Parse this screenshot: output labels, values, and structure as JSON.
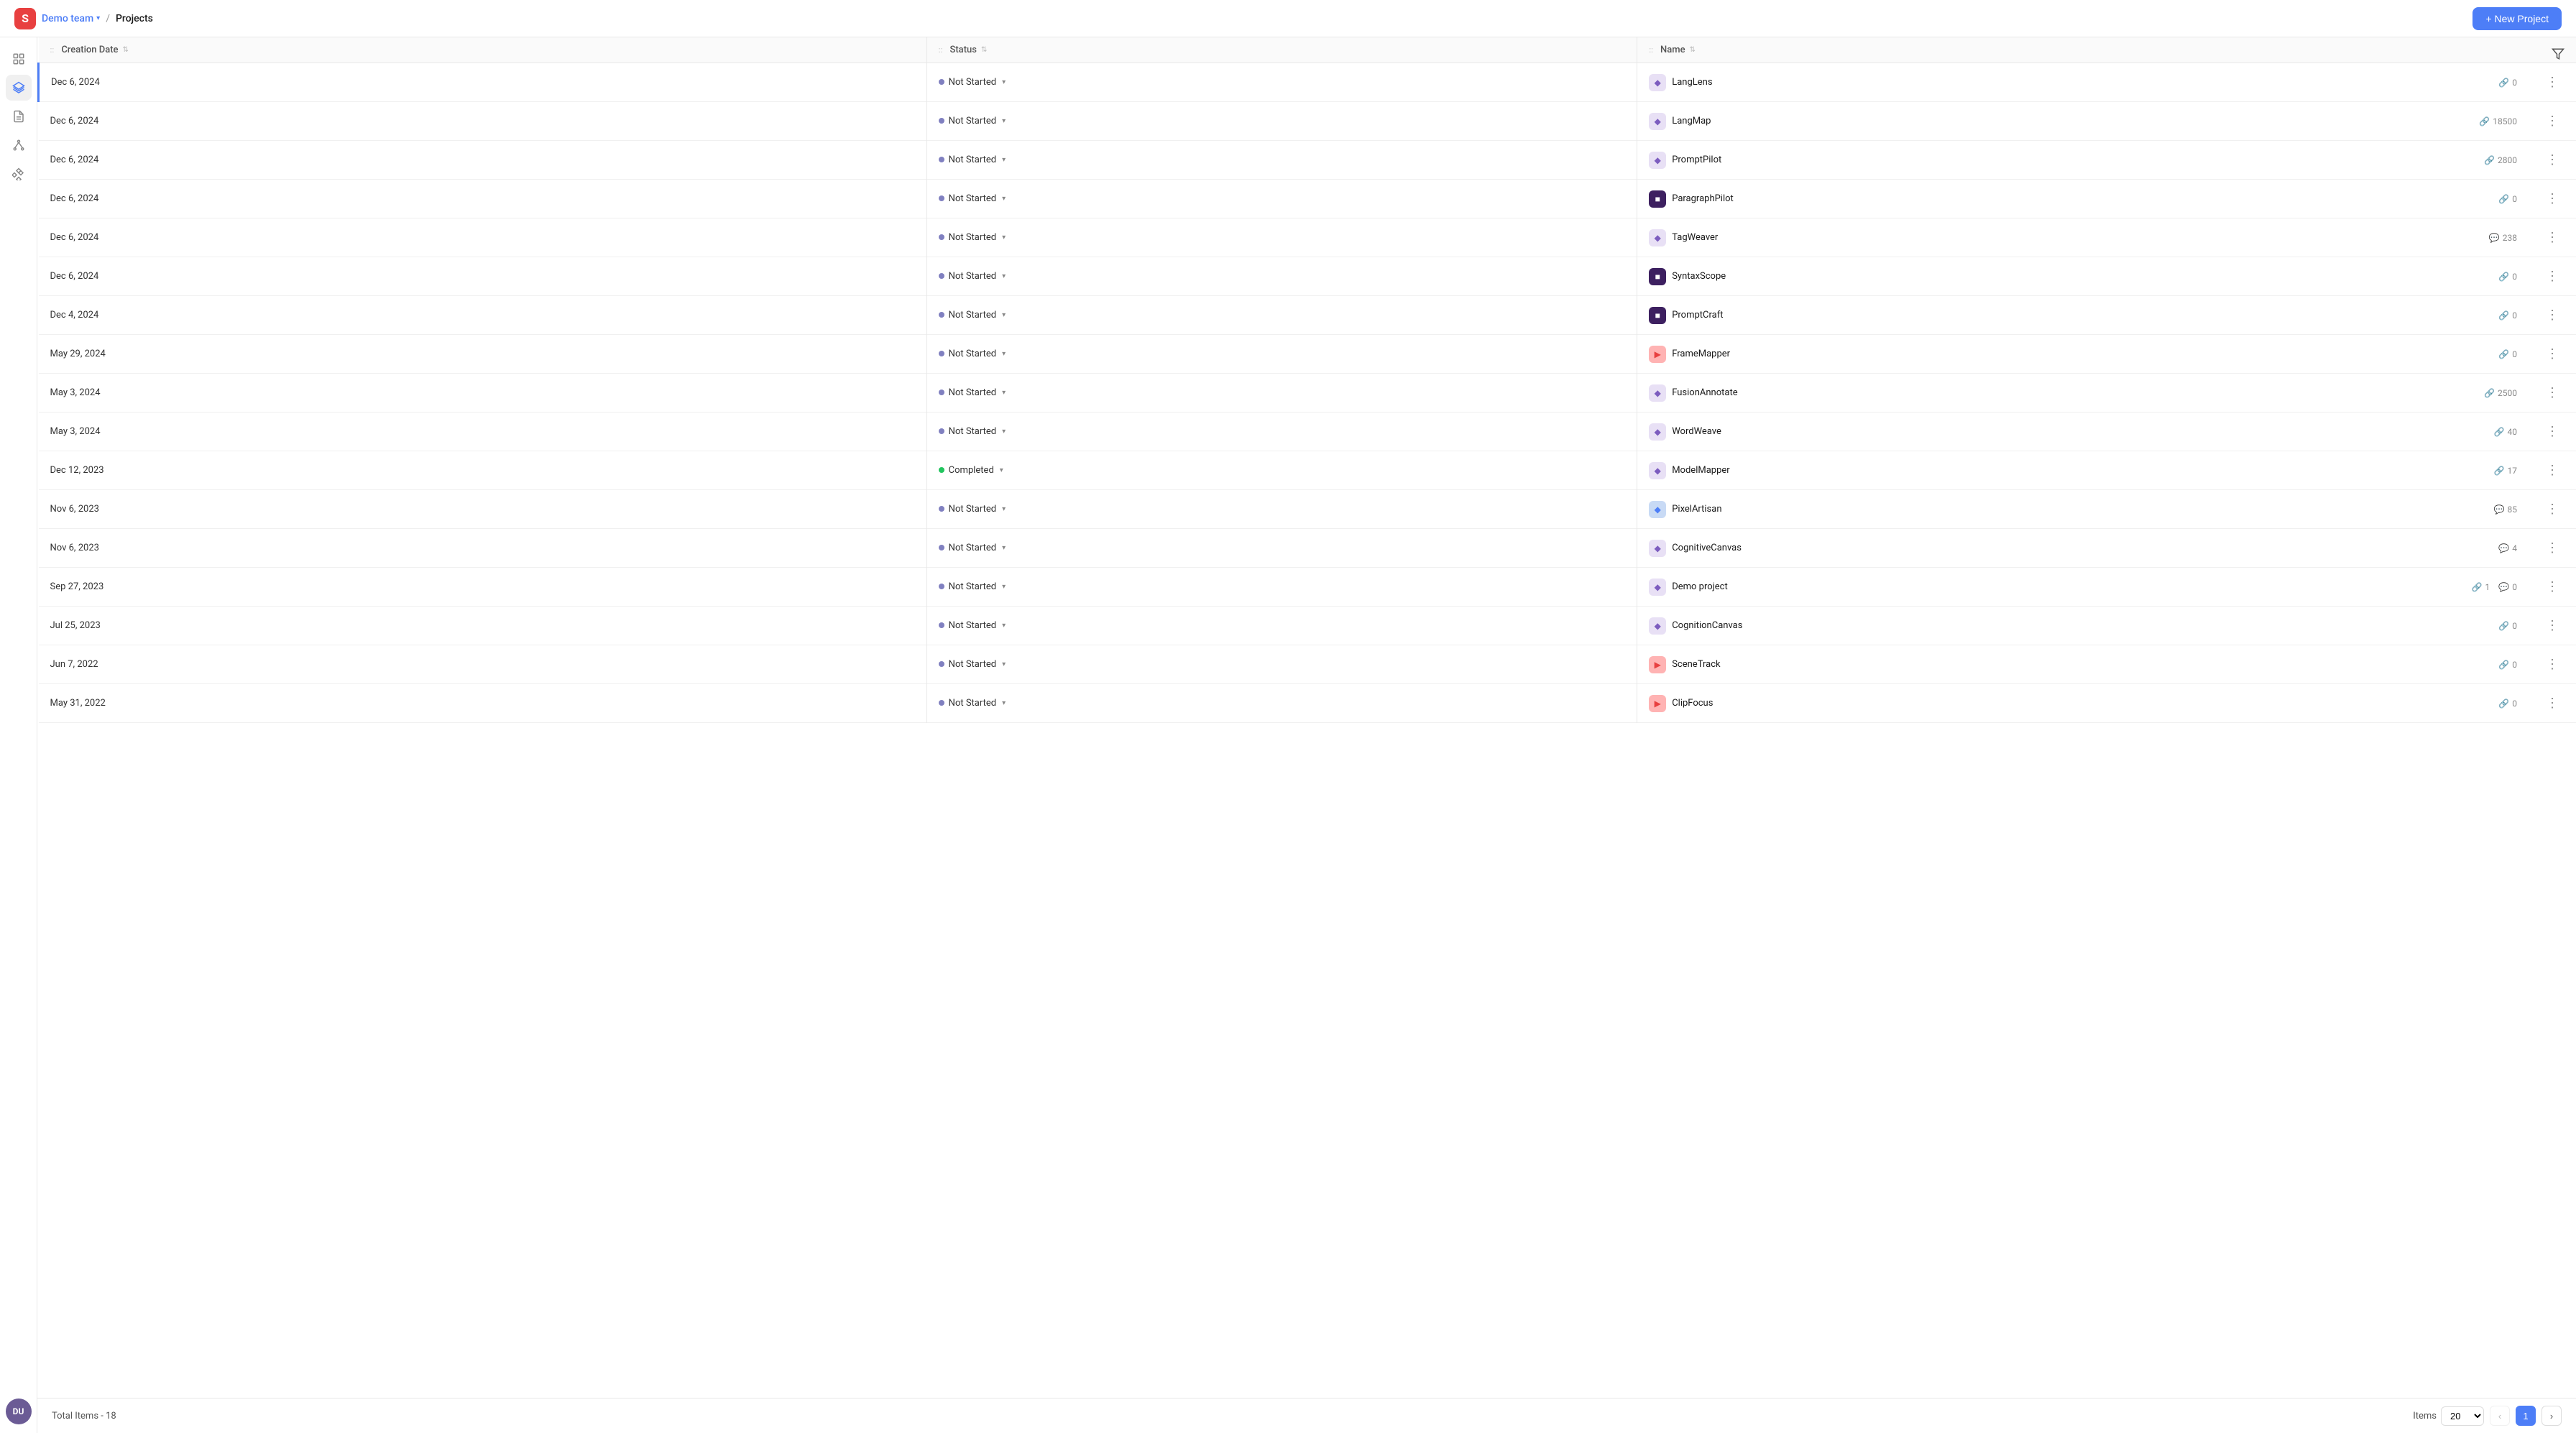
{
  "header": {
    "logo_letter": "S",
    "team_name": "Demo team",
    "team_chevron": "▾",
    "breadcrumb_sep": "/",
    "page_title": "Projects",
    "new_project_btn": "+ New Project"
  },
  "sidebar": {
    "items": [
      {
        "id": "home",
        "icon": "grid",
        "active": false
      },
      {
        "id": "layers",
        "icon": "layers",
        "active": true
      },
      {
        "id": "docs",
        "icon": "file",
        "active": false
      },
      {
        "id": "network",
        "icon": "network",
        "active": false
      },
      {
        "id": "components",
        "icon": "components",
        "active": false
      }
    ],
    "avatar_initials": "DU"
  },
  "table": {
    "columns": [
      {
        "id": "creation_date",
        "label": "Creation Date"
      },
      {
        "id": "status",
        "label": "Status"
      },
      {
        "id": "name",
        "label": "Name"
      }
    ],
    "rows": [
      {
        "id": 1,
        "date": "Dec 6, 2024",
        "status": "Not Started",
        "status_type": "not-started",
        "name": "LangLens",
        "icon_bg": "#e8e0f5",
        "icon_color": "#7c5cbf",
        "icon_char": "◆",
        "link_icon": true,
        "link_count": "0",
        "comment_count": null,
        "selected": true
      },
      {
        "id": 2,
        "date": "Dec 6, 2024",
        "status": "Not Started",
        "status_type": "not-started",
        "name": "LangMap",
        "icon_bg": "#e8e0f5",
        "icon_color": "#7c5cbf",
        "icon_char": "◆",
        "link_icon": true,
        "link_count": "18500",
        "comment_count": null,
        "selected": false
      },
      {
        "id": 3,
        "date": "Dec 6, 2024",
        "status": "Not Started",
        "status_type": "not-started",
        "name": "PromptPilot",
        "icon_bg": "#e8e0f5",
        "icon_color": "#7c5cbf",
        "icon_char": "◆",
        "link_icon": true,
        "link_count": "2800",
        "comment_count": null,
        "selected": false
      },
      {
        "id": 4,
        "date": "Dec 6, 2024",
        "status": "Not Started",
        "status_type": "not-started",
        "name": "ParagraphPilot",
        "icon_bg": "#3d2060",
        "icon_color": "#fff",
        "icon_char": "■",
        "link_icon": true,
        "link_count": "0",
        "comment_count": null,
        "selected": false
      },
      {
        "id": 5,
        "date": "Dec 6, 2024",
        "status": "Not Started",
        "status_type": "not-started",
        "name": "TagWeaver",
        "icon_bg": "#e8e0f5",
        "icon_color": "#7c5cbf",
        "icon_char": "◆",
        "link_icon": false,
        "link_count": null,
        "comment_count": "238",
        "selected": false
      },
      {
        "id": 6,
        "date": "Dec 6, 2024",
        "status": "Not Started",
        "status_type": "not-started",
        "name": "SyntaxScope",
        "icon_bg": "#3d2060",
        "icon_color": "#fff",
        "icon_char": "■",
        "link_icon": true,
        "link_count": "0",
        "comment_count": null,
        "selected": false
      },
      {
        "id": 7,
        "date": "Dec 4, 2024",
        "status": "Not Started",
        "status_type": "not-started",
        "name": "PromptCraft",
        "icon_bg": "#3d2060",
        "icon_color": "#fff",
        "icon_char": "■",
        "link_icon": true,
        "link_count": "0",
        "comment_count": null,
        "selected": false
      },
      {
        "id": 8,
        "date": "May 29, 2024",
        "status": "Not Started",
        "status_type": "not-started",
        "name": "FrameMapper",
        "icon_bg": "#ffb3b3",
        "icon_color": "#e84040",
        "icon_char": "▶",
        "link_icon": true,
        "link_count": "0",
        "comment_count": null,
        "selected": false
      },
      {
        "id": 9,
        "date": "May 3, 2024",
        "status": "Not Started",
        "status_type": "not-started",
        "name": "FusionAnnotate",
        "icon_bg": "#e8e0f5",
        "icon_color": "#7c5cbf",
        "icon_char": "◆",
        "link_icon": true,
        "link_count": "2500",
        "comment_count": null,
        "selected": false
      },
      {
        "id": 10,
        "date": "May 3, 2024",
        "status": "Not Started",
        "status_type": "not-started",
        "name": "WordWeave",
        "icon_bg": "#e8e0f5",
        "icon_color": "#7c5cbf",
        "icon_char": "◆",
        "link_icon": true,
        "link_count": "40",
        "comment_count": null,
        "selected": false
      },
      {
        "id": 11,
        "date": "Dec 12, 2023",
        "status": "Completed",
        "status_type": "completed",
        "name": "ModelMapper",
        "icon_bg": "#e8e0f5",
        "icon_color": "#7c5cbf",
        "icon_char": "◆",
        "link_icon": true,
        "link_count": "17",
        "comment_count": null,
        "selected": false
      },
      {
        "id": 12,
        "date": "Nov 6, 2023",
        "status": "Not Started",
        "status_type": "not-started",
        "name": "PixelArtisan",
        "icon_bg": "#c8daf5",
        "icon_color": "#4d7ef7",
        "icon_char": "◆",
        "link_icon": false,
        "link_count": null,
        "comment_count": "85",
        "selected": false
      },
      {
        "id": 13,
        "date": "Nov 6, 2023",
        "status": "Not Started",
        "status_type": "not-started",
        "name": "CognitiveCanvas",
        "icon_bg": "#e8e0f5",
        "icon_color": "#7c5cbf",
        "icon_char": "◆",
        "link_icon": false,
        "link_count": null,
        "comment_count": "4",
        "selected": false
      },
      {
        "id": 14,
        "date": "Sep 27, 2023",
        "status": "Not Started",
        "status_type": "not-started",
        "name": "Demo project",
        "icon_bg": "#e8e0f5",
        "icon_color": "#7c5cbf",
        "icon_char": "◆",
        "link_icon": true,
        "link_count": "1",
        "comment_count": "0",
        "selected": false
      },
      {
        "id": 15,
        "date": "Jul 25, 2023",
        "status": "Not Started",
        "status_type": "not-started",
        "name": "CognitionCanvas",
        "icon_bg": "#e8e0f5",
        "icon_color": "#7c5cbf",
        "icon_char": "◆",
        "link_icon": true,
        "link_count": "0",
        "comment_count": null,
        "selected": false
      },
      {
        "id": 16,
        "date": "Jun 7, 2022",
        "status": "Not Started",
        "status_type": "not-started",
        "name": "SceneTrack",
        "icon_bg": "#ffb3b3",
        "icon_color": "#e84040",
        "icon_char": "▶",
        "link_icon": true,
        "link_count": "0",
        "comment_count": null,
        "selected": false
      },
      {
        "id": 17,
        "date": "May 31, 2022",
        "status": "Not Started",
        "status_type": "not-started",
        "name": "ClipFocus",
        "icon_bg": "#ffb3b3",
        "icon_color": "#e84040",
        "icon_char": "▶",
        "link_icon": true,
        "link_count": "0",
        "comment_count": null,
        "selected": false
      }
    ]
  },
  "footer": {
    "total_items_label": "Total Items -",
    "total_items_count": "18",
    "items_per_page_label": "Items",
    "items_per_page_value": "20",
    "current_page": "1"
  }
}
